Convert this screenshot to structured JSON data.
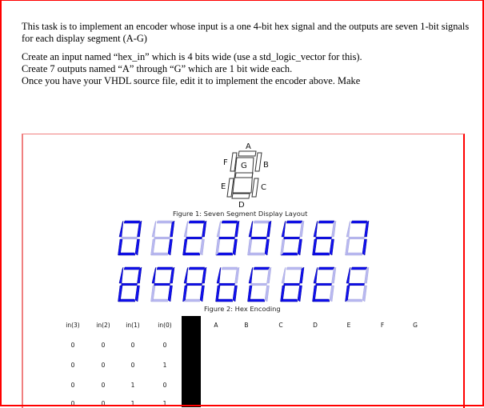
{
  "document": {
    "paragraph1": "This task is to implement an encoder whose input is a one 4-bit hex signal and the outputs are seven 1-bit signals for each display segment (A-G)",
    "line2": "Create an input named “hex_in” which is 4 bits wide (use a std_logic_vector for this).",
    "line3": "Create 7 outputs named “A” through “G” which are 1 bit wide each.",
    "line4": "Once you have your VHDL source file, edit it to implement the encoder above. Make"
  },
  "figure1": {
    "caption": "Figure 1: Seven Segment Display Layout",
    "segment_labels": {
      "A": "A",
      "B": "B",
      "C": "C",
      "D": "D",
      "E": "E",
      "F": "F",
      "G": "G"
    }
  },
  "figure2": {
    "caption": "Figure 2: Hex Encoding",
    "colors": {
      "on": "#1010f0",
      "off": "#b8b8f0"
    },
    "digits_row1": [
      {
        "glyph": "0",
        "on": "ABCDEF"
      },
      {
        "glyph": "1",
        "on": "BC"
      },
      {
        "glyph": "2",
        "on": "ABDEG"
      },
      {
        "glyph": "3",
        "on": "ABCDG"
      },
      {
        "glyph": "4",
        "on": "BCFG"
      },
      {
        "glyph": "5",
        "on": "ACDFG"
      },
      {
        "glyph": "6",
        "on": "ACDEFG"
      },
      {
        "glyph": "7",
        "on": "ABC"
      }
    ],
    "digits_row2": [
      {
        "glyph": "8",
        "on": "ABCDEFG"
      },
      {
        "glyph": "9",
        "on": "ABCFG"
      },
      {
        "glyph": "A",
        "on": "ABCEFG"
      },
      {
        "glyph": "b",
        "on": "CDEFG"
      },
      {
        "glyph": "C",
        "on": "ADEF"
      },
      {
        "glyph": "d",
        "on": "BCDEG"
      },
      {
        "glyph": "E",
        "on": "ADEFG"
      },
      {
        "glyph": "F",
        "on": "AEFG"
      }
    ]
  },
  "truth_table": {
    "headers": [
      "in(3)",
      "in(2)",
      "in(1)",
      "in(0)",
      "A",
      "B",
      "C",
      "D",
      "E",
      "F",
      "G"
    ],
    "rows": [
      [
        "0",
        "0",
        "0",
        "0"
      ],
      [
        "0",
        "0",
        "0",
        "1"
      ],
      [
        "0",
        "0",
        "1",
        "0"
      ],
      [
        "0",
        "0",
        "1",
        "1"
      ]
    ]
  }
}
